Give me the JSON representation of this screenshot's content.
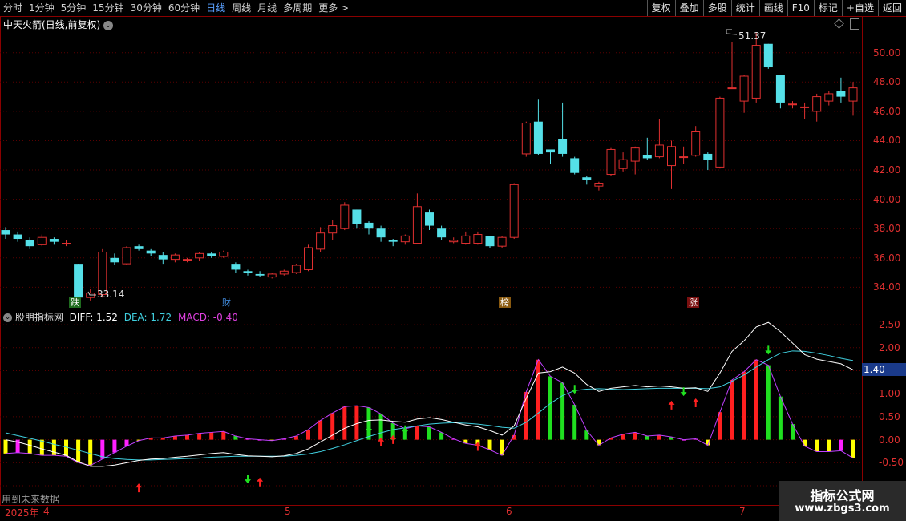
{
  "toolbar": {
    "periods": [
      "分时",
      "1分钟",
      "5分钟",
      "15分钟",
      "30分钟",
      "60分钟",
      "日线",
      "周线",
      "月线",
      "多周期",
      "更多 >"
    ],
    "active_period": "日线",
    "right_buttons": [
      "复权",
      "叠加",
      "多股",
      "统计",
      "画线",
      "F10",
      "标记",
      "+自选",
      "返回"
    ]
  },
  "main_chart": {
    "title": "中天火箭(日线,前复权)",
    "high_label": "51.37",
    "low_label": "33.14",
    "y_ticks": [
      "50.00",
      "48.00",
      "46.00",
      "44.00",
      "42.00",
      "40.00",
      "38.00",
      "36.00",
      "34.00"
    ],
    "badges": [
      "跌",
      "财",
      "榜",
      "涨"
    ]
  },
  "indicator": {
    "name": "股朋指标网",
    "diff_label": "DIFF: 1.52",
    "dea_label": "DEA: 1.72",
    "macd_label": "MACD: -0.40",
    "y_ticks": [
      "2.50",
      "2.00",
      "1.40",
      "1.00",
      "0.50",
      "0.00",
      "-0.50"
    ],
    "current_value": "1.40",
    "footer_note": "用到未来数据"
  },
  "x_axis": {
    "labels": [
      "2025年",
      "4",
      "5",
      "6",
      "7"
    ]
  },
  "watermark": {
    "line1": "指标公式网",
    "line2": "www.zbgs3.com"
  },
  "colors": {
    "up": "#e03030",
    "down": "#55e0e8",
    "diff": "#ffffff",
    "dea": "#40d0e0",
    "macd_pos": "#ff2020",
    "macd_neg": "#ffff00"
  },
  "chart_data": {
    "type": "candlestick",
    "y_range": [
      32.6,
      52.5
    ],
    "candles": [
      [
        37.9,
        37.6,
        38.1,
        37.3
      ],
      [
        37.6,
        37.3,
        37.8,
        37.1
      ],
      [
        37.2,
        36.8,
        37.4,
        36.6
      ],
      [
        36.9,
        37.4,
        37.6,
        36.8
      ],
      [
        37.3,
        37.1,
        37.4,
        36.9
      ],
      [
        37.0,
        37.0,
        37.2,
        36.8
      ],
      [
        35.6,
        33.3,
        35.6,
        33.2
      ],
      [
        33.3,
        33.6,
        33.9,
        33.1
      ],
      [
        33.5,
        36.4,
        36.6,
        33.3
      ],
      [
        36.0,
        35.7,
        36.3,
        35.5
      ],
      [
        35.6,
        36.7,
        36.8,
        35.5
      ],
      [
        36.8,
        36.6,
        36.9,
        36.5
      ],
      [
        36.5,
        36.3,
        36.6,
        36.1
      ],
      [
        36.2,
        35.9,
        36.4,
        35.6
      ],
      [
        35.9,
        36.2,
        36.3,
        35.7
      ],
      [
        35.9,
        35.9,
        36.0,
        35.7
      ],
      [
        36.0,
        36.3,
        36.4,
        35.8
      ],
      [
        36.3,
        36.1,
        36.4,
        36.0
      ],
      [
        36.1,
        36.4,
        36.5,
        36.0
      ],
      [
        35.6,
        35.2,
        35.7,
        35.0
      ],
      [
        35.1,
        35.0,
        35.2,
        34.8
      ],
      [
        34.9,
        34.8,
        35.1,
        34.7
      ],
      [
        34.7,
        34.9,
        35.0,
        34.6
      ],
      [
        34.9,
        35.1,
        35.2,
        34.8
      ],
      [
        35.0,
        35.5,
        35.6,
        34.9
      ],
      [
        35.2,
        36.7,
        36.9,
        35.1
      ],
      [
        36.6,
        37.7,
        38.1,
        36.4
      ],
      [
        37.7,
        38.2,
        38.6,
        37.2
      ],
      [
        38.0,
        39.6,
        39.8,
        37.9
      ],
      [
        39.3,
        38.3,
        39.3,
        38.0
      ],
      [
        38.4,
        38.0,
        38.5,
        37.6
      ],
      [
        38.0,
        37.4,
        38.2,
        37.1
      ],
      [
        37.2,
        37.1,
        37.3,
        36.8
      ],
      [
        37.1,
        37.5,
        37.6,
        36.9
      ],
      [
        37.0,
        39.5,
        40.4,
        37.0
      ],
      [
        39.1,
        38.2,
        39.3,
        37.9
      ],
      [
        38.0,
        37.4,
        38.2,
        37.2
      ],
      [
        37.1,
        37.2,
        37.4,
        37.0
      ],
      [
        37.0,
        37.5,
        37.8,
        36.9
      ],
      [
        37.0,
        37.6,
        37.8,
        36.9
      ],
      [
        37.5,
        36.8,
        37.5,
        36.7
      ],
      [
        36.8,
        37.4,
        37.5,
        36.7
      ],
      [
        37.4,
        41.0,
        41.1,
        37.3
      ],
      [
        43.1,
        45.2,
        45.3,
        42.9
      ],
      [
        45.3,
        43.1,
        46.8,
        43.0
      ],
      [
        43.4,
        43.2,
        43.4,
        42.4
      ],
      [
        44.1,
        43.1,
        46.6,
        42.9
      ],
      [
        42.8,
        41.8,
        42.9,
        41.7
      ],
      [
        41.5,
        41.3,
        41.6,
        41.0
      ],
      [
        40.9,
        41.1,
        41.2,
        40.6
      ],
      [
        41.7,
        43.4,
        43.5,
        41.6
      ],
      [
        42.1,
        42.7,
        43.2,
        41.9
      ],
      [
        42.6,
        43.5,
        43.6,
        41.7
      ],
      [
        43.0,
        42.8,
        44.2,
        42.7
      ],
      [
        42.9,
        43.7,
        45.5,
        42.8
      ],
      [
        42.3,
        43.6,
        44.0,
        40.7
      ],
      [
        42.9,
        42.9,
        43.6,
        42.4
      ],
      [
        43.0,
        44.6,
        45.0,
        42.9
      ],
      [
        43.1,
        42.7,
        43.2,
        42.0
      ],
      [
        42.2,
        46.9,
        47.0,
        42.1
      ],
      [
        47.6,
        47.6,
        50.7,
        47.6
      ],
      [
        46.7,
        48.4,
        48.5,
        45.9
      ],
      [
        46.9,
        50.5,
        51.4,
        46.6
      ],
      [
        50.6,
        49.0,
        50.6,
        48.9
      ],
      [
        48.5,
        46.6,
        48.5,
        46.2
      ],
      [
        46.5,
        46.5,
        46.7,
        46.2
      ],
      [
        46.3,
        46.3,
        46.6,
        45.5
      ],
      [
        46.0,
        47.0,
        47.2,
        45.3
      ],
      [
        46.7,
        47.2,
        47.4,
        46.4
      ],
      [
        47.4,
        47.0,
        48.3,
        46.6
      ],
      [
        46.7,
        47.6,
        48.0,
        45.7
      ]
    ],
    "dif": [
      0.0,
      -0.05,
      -0.12,
      -0.2,
      -0.27,
      -0.34,
      -0.48,
      -0.58,
      -0.58,
      -0.55,
      -0.5,
      -0.45,
      -0.42,
      -0.41,
      -0.38,
      -0.36,
      -0.33,
      -0.3,
      -0.28,
      -0.32,
      -0.35,
      -0.36,
      -0.37,
      -0.35,
      -0.3,
      -0.2,
      -0.05,
      0.1,
      0.25,
      0.35,
      0.42,
      0.43,
      0.4,
      0.38,
      0.45,
      0.48,
      0.44,
      0.38,
      0.32,
      0.28,
      0.2,
      0.1,
      0.3,
      0.9,
      1.45,
      1.48,
      1.58,
      1.45,
      1.2,
      1.05,
      1.12,
      1.15,
      1.18,
      1.15,
      1.17,
      1.15,
      1.12,
      1.13,
      1.05,
      1.45,
      1.92,
      2.15,
      2.45,
      2.55,
      2.35,
      2.1,
      1.85,
      1.75,
      1.7,
      1.65,
      1.52
    ],
    "dea": [
      0.15,
      0.09,
      0.03,
      -0.03,
      -0.1,
      -0.16,
      -0.23,
      -0.3,
      -0.37,
      -0.41,
      -0.43,
      -0.44,
      -0.44,
      -0.43,
      -0.42,
      -0.41,
      -0.4,
      -0.38,
      -0.37,
      -0.36,
      -0.36,
      -0.36,
      -0.36,
      -0.36,
      -0.34,
      -0.31,
      -0.26,
      -0.19,
      -0.11,
      -0.02,
      0.07,
      0.15,
      0.22,
      0.26,
      0.3,
      0.34,
      0.36,
      0.37,
      0.36,
      0.34,
      0.31,
      0.27,
      0.25,
      0.38,
      0.58,
      0.79,
      0.96,
      1.07,
      1.1,
      1.11,
      1.1,
      1.09,
      1.1,
      1.11,
      1.12,
      1.12,
      1.12,
      1.12,
      1.11,
      1.15,
      1.27,
      1.41,
      1.58,
      1.74,
      1.88,
      1.93,
      1.92,
      1.88,
      1.83,
      1.77,
      1.72
    ]
  }
}
